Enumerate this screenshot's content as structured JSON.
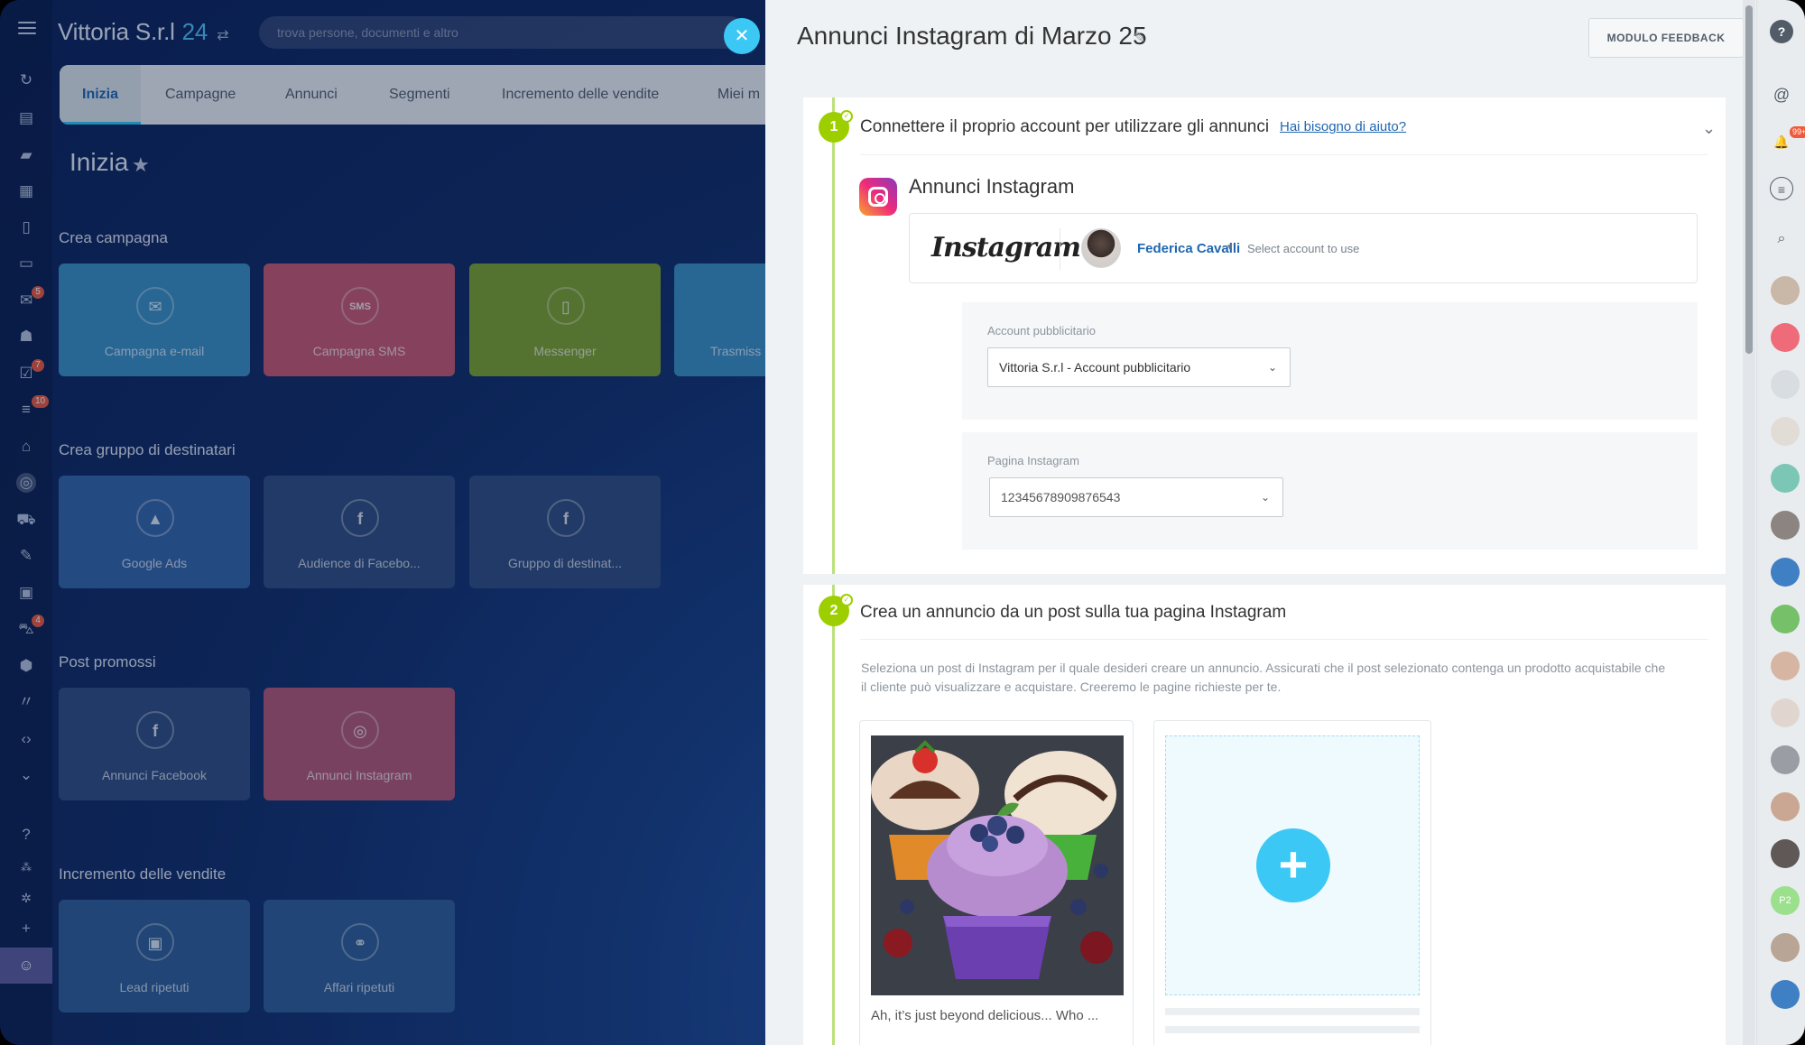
{
  "portal": {
    "name": "Vittoria S.r.l",
    "number": "24"
  },
  "search": {
    "placeholder": "trova persone, documenti e altro"
  },
  "tabs": [
    {
      "label": "Inizia"
    },
    {
      "label": "Campagne"
    },
    {
      "label": "Annunci"
    },
    {
      "label": "Segmenti"
    },
    {
      "label": "Incremento delle vendite"
    },
    {
      "label": "Miei m"
    }
  ],
  "page": {
    "title": "Inizia"
  },
  "sections": {
    "campaign": {
      "title": "Crea campagna",
      "tiles": [
        {
          "label": "Campagna e-mail",
          "color": "#3a8fc4"
        },
        {
          "label": "Campagna SMS",
          "color": "#c9586e"
        },
        {
          "label": "Messenger",
          "color": "#7fa32a"
        },
        {
          "label": "Trasmiss",
          "color": "#3a8fc4"
        }
      ]
    },
    "audience": {
      "title": "Crea gruppo di destinatari",
      "tiles": [
        {
          "label": "Google Ads",
          "color": "#3465a8"
        },
        {
          "label": "Audience di Facebo...",
          "color": "#2f4c7e"
        },
        {
          "label": "Gruppo di destinat...",
          "color": "#2f4c7e"
        }
      ]
    },
    "promoted": {
      "title": "Post promossi",
      "tiles": [
        {
          "label": "Annunci Facebook",
          "color": "#2f4c7e"
        },
        {
          "label": "Annunci Instagram",
          "color": "#b65773"
        }
      ]
    },
    "sales": {
      "title": "Incremento delle vendite",
      "tiles": [
        {
          "label": "Lead ripetuti",
          "color": "#2d5d95"
        },
        {
          "label": "Affari ripetuti",
          "color": "#2d5d95"
        }
      ]
    }
  },
  "rail": {
    "badges": [
      "5",
      "7",
      "10",
      "4"
    ]
  },
  "slider": {
    "title": "Annunci Instagram di Marzo 25",
    "feedback_button": "MODULO FEEDBACK",
    "step1": {
      "number": "1",
      "title": "Connettere il proprio account per utilizzare gli annunci",
      "help_link": "Hai bisogno di aiuto?",
      "service_title": "Annunci Instagram",
      "wordmark": "Instagram",
      "user_name": "Federica Cavalli",
      "select_hint": "Select account to use",
      "ad_account_label": "Account pubblicitario",
      "ad_account_value": "Vittoria S.r.l - Account pubblicitario",
      "ig_page_label": "Pagina Instagram",
      "ig_page_value": "12345678909876543"
    },
    "step2": {
      "number": "2",
      "title": "Crea un annuncio da un post sulla tua pagina Instagram",
      "description": "Seleziona un post di Instagram per il quale desideri creare un annuncio. Assicurati che il post selezionato contenga un prodotto acquistabile che il cliente può visualizzare e acquistare. Creeremo le pagine richieste per te.",
      "post_caption": "Ah, it’s just beyond delicious... Who ..."
    }
  },
  "right_rail": {
    "notification_badge": "99+",
    "avatar_initials": "P2"
  }
}
